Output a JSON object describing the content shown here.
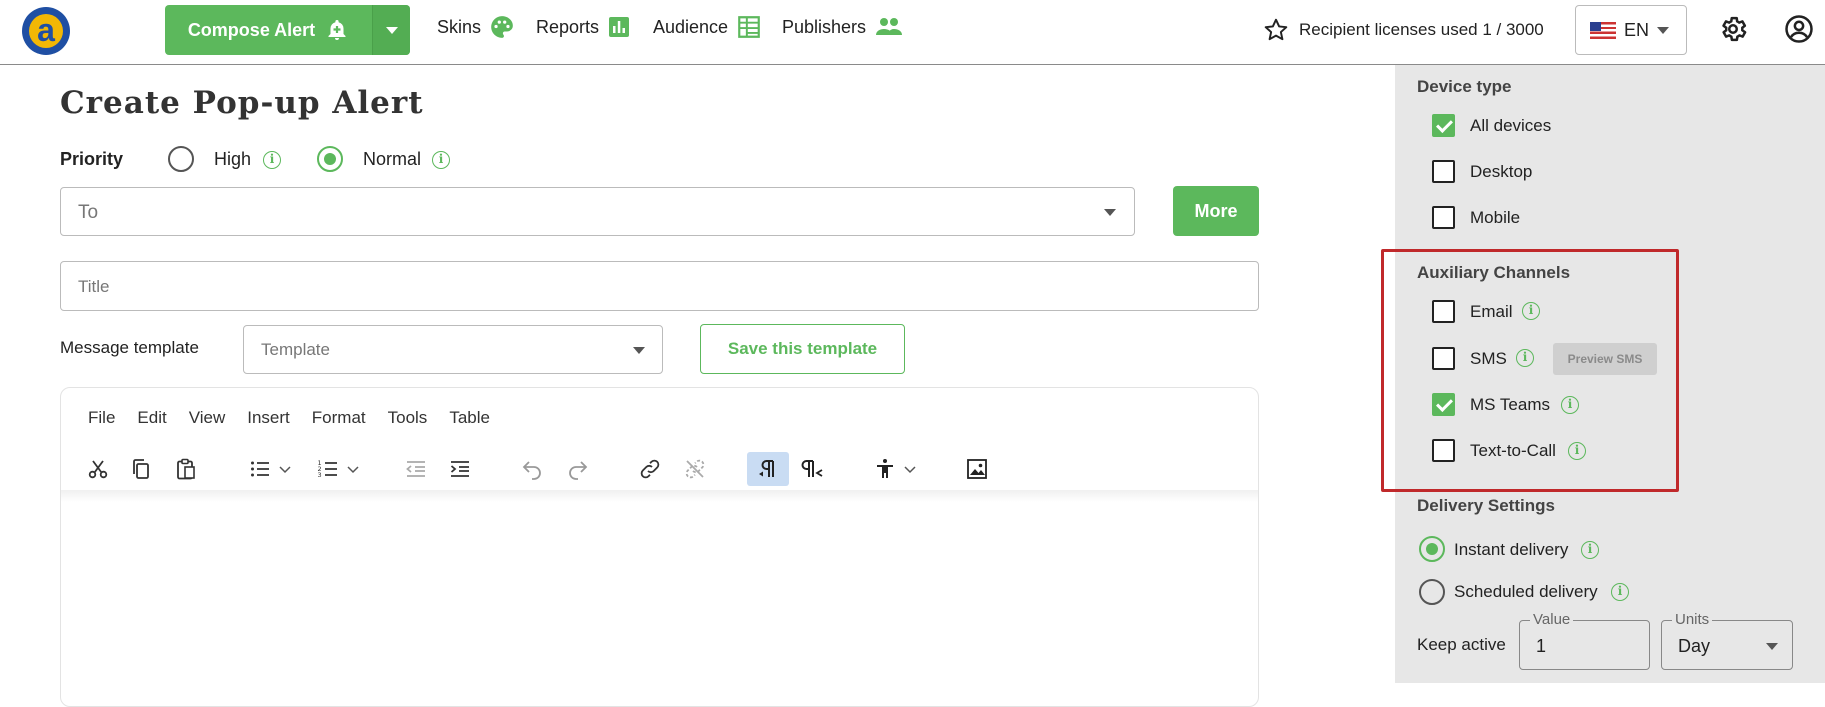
{
  "app": {
    "logo_letter": "a"
  },
  "header": {
    "compose_label": "Compose Alert",
    "nav": [
      {
        "label": "Skins",
        "icon": "palette-icon"
      },
      {
        "label": "Reports",
        "icon": "bar-chart-icon"
      },
      {
        "label": "Audience",
        "icon": "audience-table-icon"
      },
      {
        "label": "Publishers",
        "icon": "people-icon"
      }
    ],
    "licenses_text": "Recipient licenses used 1 / 3000",
    "language": "EN"
  },
  "page": {
    "title": "Create Pop-up Alert",
    "priority": {
      "label": "Priority",
      "options": [
        {
          "label": "High",
          "selected": false
        },
        {
          "label": "Normal",
          "selected": true
        }
      ]
    },
    "to_placeholder": "To",
    "more_label": "More",
    "title_placeholder": "Title",
    "message_template_label": "Message template",
    "template_placeholder": "Template",
    "save_template_label": "Save this template"
  },
  "editor": {
    "menu": [
      "File",
      "Edit",
      "View",
      "Insert",
      "Format",
      "Tools",
      "Table"
    ],
    "tools": [
      "cut",
      "copy",
      "paste",
      "bullet-list",
      "numbered-list",
      "outdent",
      "indent",
      "undo",
      "redo",
      "link",
      "unlink",
      "ltr",
      "rtl",
      "accessibility",
      "image"
    ],
    "active_tool": "ltr"
  },
  "sidebar": {
    "device_type": {
      "title": "Device type",
      "options": [
        {
          "label": "All devices",
          "checked": true
        },
        {
          "label": "Desktop",
          "checked": false
        },
        {
          "label": "Mobile",
          "checked": false
        }
      ]
    },
    "auxiliary": {
      "title": "Auxiliary Channels",
      "options": [
        {
          "label": "Email",
          "checked": false
        },
        {
          "label": "SMS",
          "checked": false
        },
        {
          "label": "MS Teams",
          "checked": true
        },
        {
          "label": "Text-to-Call",
          "checked": false
        }
      ],
      "preview_sms_label": "Preview SMS"
    },
    "delivery": {
      "title": "Delivery Settings",
      "options": [
        {
          "label": "Instant delivery",
          "selected": true
        },
        {
          "label": "Scheduled delivery",
          "selected": false
        }
      ]
    },
    "keep_active": {
      "label": "Keep active",
      "value_label": "Value",
      "value": "1",
      "units_label": "Units",
      "units": "Day"
    }
  },
  "colors": {
    "accent_green": "#5cb85c",
    "highlight_red": "#c0292b",
    "panel_bg": "#e7e7e7",
    "active_tool_bg": "#c9dcf3"
  }
}
